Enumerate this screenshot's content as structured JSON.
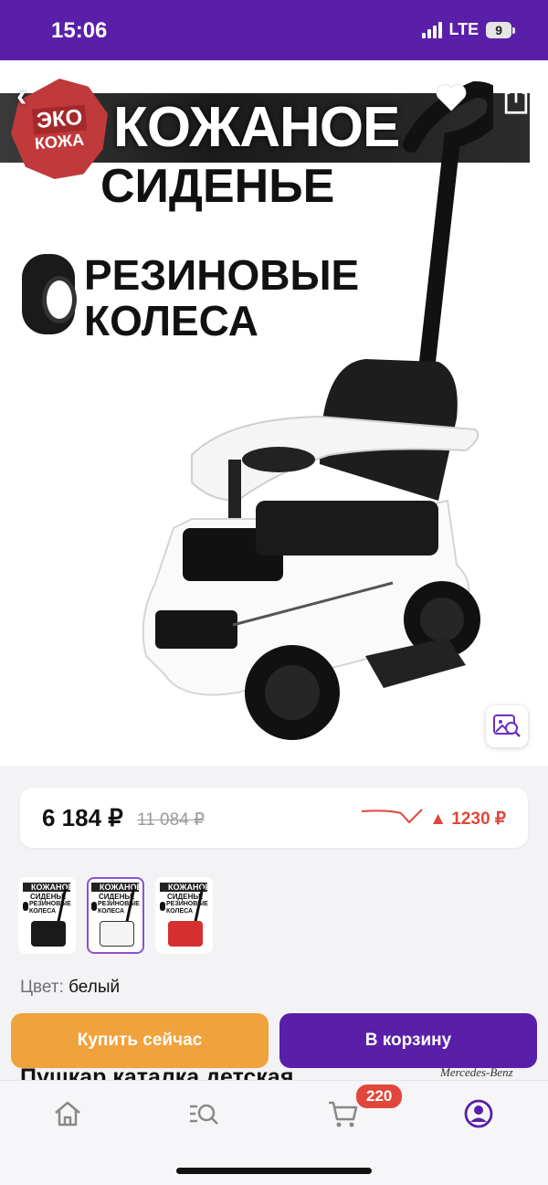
{
  "status_bar": {
    "time": "15:06",
    "network": "LTE",
    "battery": "9"
  },
  "product_image": {
    "badge_line1": "ЭКО",
    "badge_line2": "КОЖА",
    "headline1": "КОЖАНОЕ",
    "headline2": "СИДЕНЬЕ",
    "feature_line1": "РЕЗИНОВЫЕ",
    "feature_line2": "КОЛЕСА"
  },
  "price": {
    "current": "6 184 ₽",
    "old": "11 084 ₽",
    "drop": "▲ 1230 ₽",
    "accent_color": "#e0473a"
  },
  "thumbnails": [
    {
      "line1": "КОЖАНОЕ",
      "line2": "СИДЕНЬЕ",
      "line3": "РЕЗИНОВЫЕ",
      "line4": "КОЛЕСА",
      "car_color": "#1a1a1a",
      "active": false
    },
    {
      "line1": "КОЖАНОЕ",
      "line2": "СИДЕНЬЕ",
      "line3": "РЕЗИНОВЫЕ",
      "line4": "КОЛЕСА",
      "car_color": "#f4f4f4",
      "active": true
    },
    {
      "line1": "КОЖАНОЕ",
      "line2": "СИДЕНЬЕ",
      "line3": "РЕЗИНОВЫЕ",
      "line4": "КОЛЕСА",
      "car_color": "#d62f2f",
      "active": false
    }
  ],
  "color_option": {
    "label": "Цвет:",
    "value": "белый"
  },
  "actions": {
    "buy_now": "Купить сейчас",
    "add_to_cart": "В корзину"
  },
  "product_title_peek": "Пушкар каталка детская",
  "brand_peek": "Mercedes-Benz",
  "tabbar": {
    "cart_count": "220",
    "icons": [
      "home-icon",
      "catalog-search-icon",
      "cart-icon",
      "profile-icon"
    ],
    "accent": "#5a1fa8"
  },
  "icons": {
    "back": "back-arrow-icon",
    "favorite": "heart-icon",
    "share": "share-icon",
    "image_search": "image-search-icon"
  }
}
